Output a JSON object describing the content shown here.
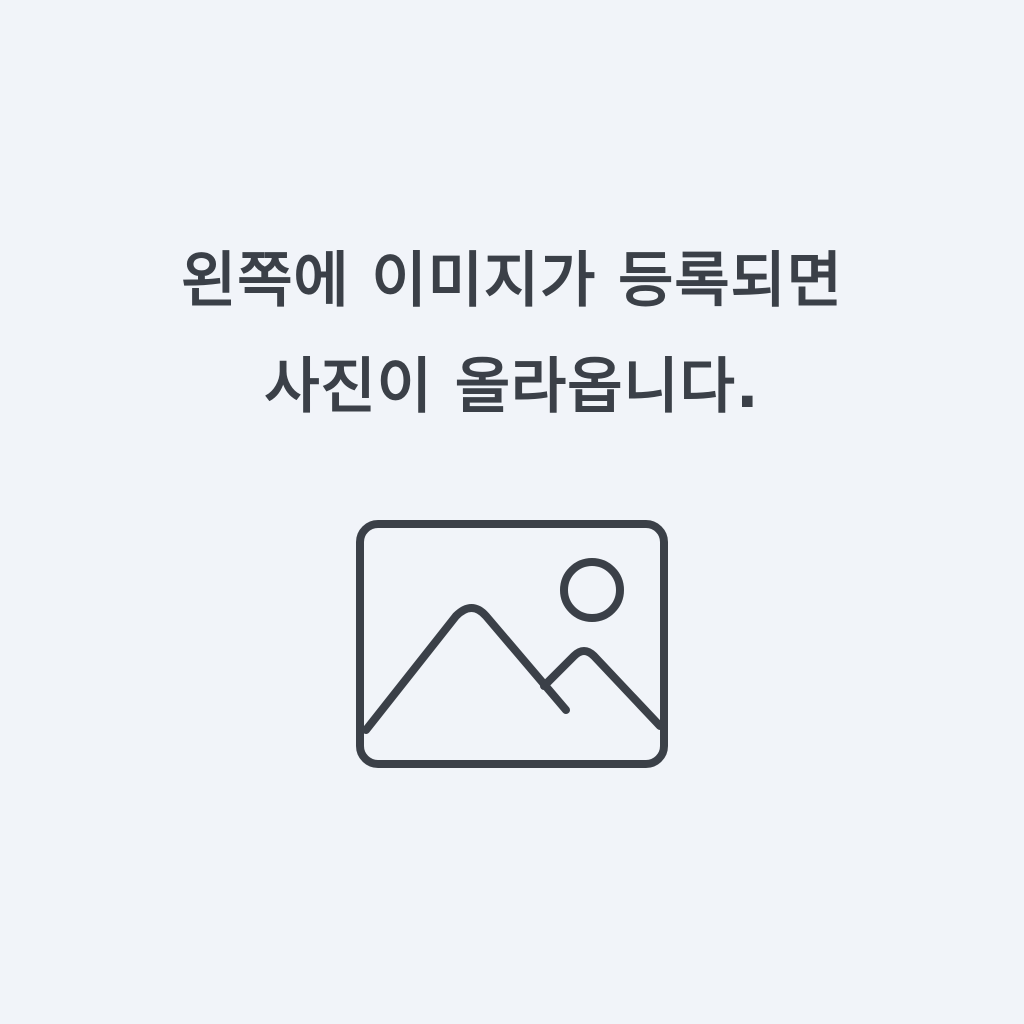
{
  "placeholder": {
    "message_line1": "왼쪽에 이미지가 등록되면",
    "message_line2": "사진이 올라옵니다.",
    "icon": "image-icon",
    "colors": {
      "background": "#f1f4f9",
      "foreground": "#3b4048"
    }
  }
}
